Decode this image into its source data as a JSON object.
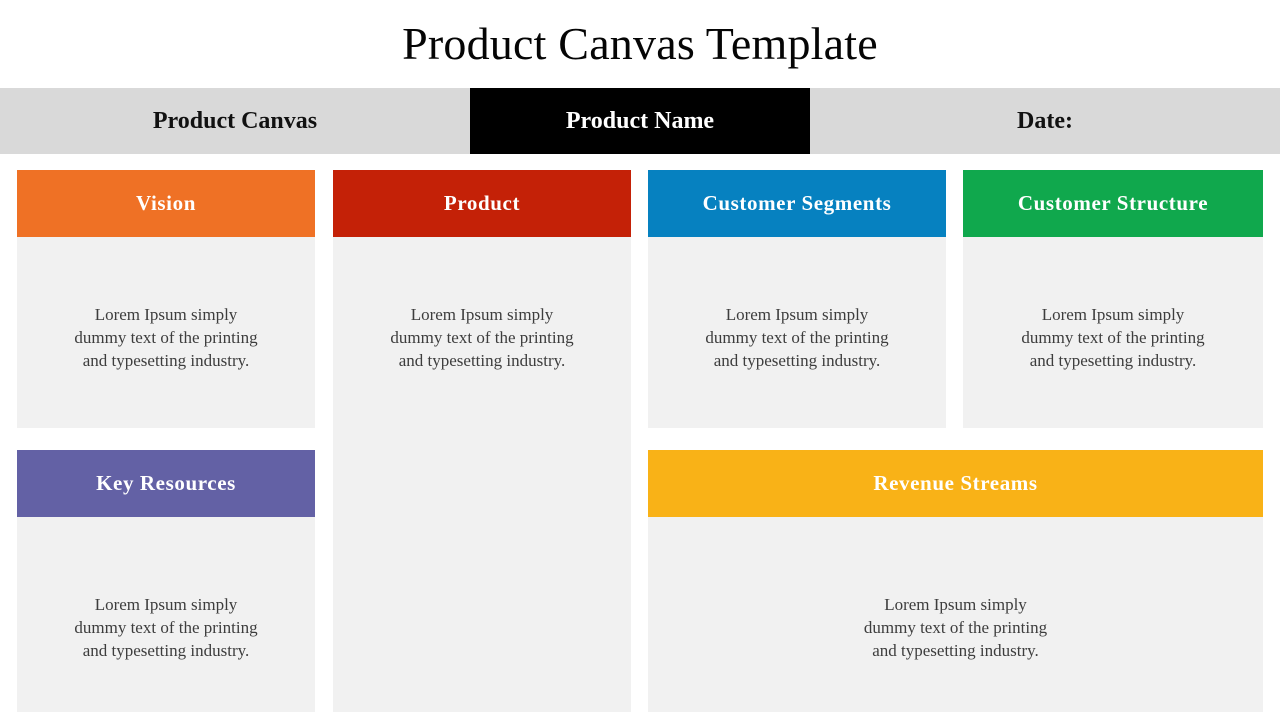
{
  "page": {
    "title": "Product Canvas Template",
    "background": "#ffffff"
  },
  "header": {
    "background": "#d9d9d9",
    "highlight_background": "#000000",
    "canvas_label": "Product Canvas",
    "product_name_label": "Product Name",
    "date_label": "Date:"
  },
  "body_text": "Lorem Ipsum simply\ndummy text of the printing\nand typesetting industry.",
  "cards": [
    {
      "id": "vision",
      "title": "Vision",
      "color": "#ef7125",
      "body": "Lorem Ipsum simply\ndummy text of the printing\nand typesetting industry."
    },
    {
      "id": "product",
      "title": "Product",
      "color": "#c42107",
      "body": "Lorem Ipsum simply\ndummy text of the printing\nand typesetting industry."
    },
    {
      "id": "customer-segments",
      "title": "Customer Segments",
      "color": "#0681c0",
      "body": "Lorem Ipsum simply\ndummy text of the printing\nand typesetting industry."
    },
    {
      "id": "customer-structure",
      "title": "Customer Structure",
      "color": "#10a84d",
      "body": "Lorem Ipsum simply\ndummy text of the printing\nand typesetting industry."
    },
    {
      "id": "key-resources",
      "title": "Key Resources",
      "color": "#6361a5",
      "body": "Lorem Ipsum simply\ndummy text of the printing\nand typesetting industry."
    },
    {
      "id": "revenue-streams",
      "title": "Revenue Streams",
      "color": "#f9b217",
      "body": "Lorem Ipsum simply\ndummy text of the printing\nand typesetting industry."
    }
  ]
}
